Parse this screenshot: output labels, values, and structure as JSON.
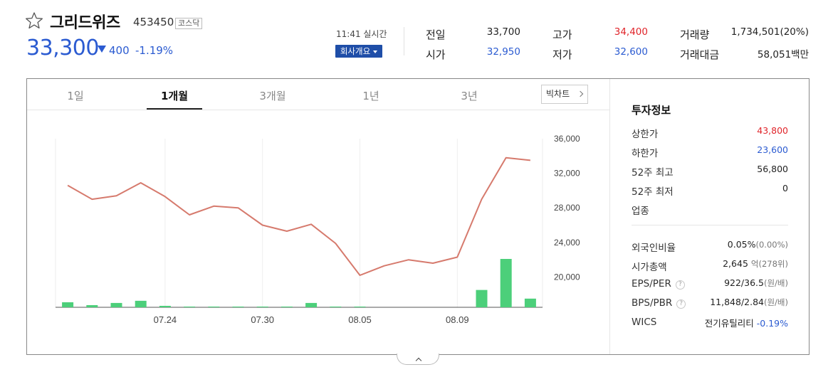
{
  "stock": {
    "name": "그리드위즈",
    "code": "453450",
    "market": "코스닥",
    "price": "33,300",
    "change": "400",
    "change_rate": "-1.19%",
    "direction": "down"
  },
  "realtime": {
    "time": "11:41 실시간",
    "company_button": "회사개요"
  },
  "quote": {
    "prev_close_label": "전일",
    "prev_close": "33,700",
    "open_label": "시가",
    "open": "32,950",
    "high_label": "고가",
    "high": "34,400",
    "low_label": "저가",
    "low": "32,600",
    "volume_label": "거래량",
    "volume": "1,734,501(20%)",
    "amount_label": "거래대금",
    "amount": "58,051백만"
  },
  "tabs": [
    "1일",
    "1개월",
    "3개월",
    "1년",
    "3년"
  ],
  "active_tab": "1개월",
  "bigchart_label": "빅차트",
  "chart_data": {
    "type": "line",
    "title": "",
    "x": [
      "07.18",
      "07.19",
      "07.22",
      "07.23",
      "07.24",
      "07.25",
      "07.26",
      "07.29",
      "07.30",
      "07.31",
      "08.01",
      "08.02",
      "08.05",
      "08.06",
      "08.07",
      "08.08",
      "08.09",
      "08.12",
      "08.13",
      "08.14"
    ],
    "x_tick_labels": [
      "07.24",
      "07.30",
      "08.05",
      "08.09"
    ],
    "series": [
      {
        "values": [
          30600,
          29000,
          29400,
          30900,
          29300,
          27200,
          28200,
          28000,
          26000,
          25300,
          26100,
          23900,
          20200,
          21300,
          22000,
          21600,
          22300,
          29000,
          33800,
          33500
        ]
      }
    ],
    "volume": [
      7,
      3,
      6,
      9,
      2,
      1,
      1,
      1,
      1,
      1,
      6,
      1,
      1,
      0,
      0,
      0,
      0,
      24,
      67,
      12
    ],
    "y_ticks": [
      "36,000",
      "32,000",
      "28,000",
      "24,000",
      "20,000"
    ],
    "ylim": [
      16500,
      36000
    ],
    "grid": true,
    "line_color": "#d67a6d",
    "volume_color": "#4ccf7a"
  },
  "invest": {
    "title": "투자정보",
    "upper_limit_label": "상한가",
    "upper_limit": "43,800",
    "lower_limit_label": "하한가",
    "lower_limit": "23,600",
    "high52_label": "52주 최고",
    "high52": "56,800",
    "low52_label": "52주 최저",
    "low52": "0",
    "industry_label": "업종",
    "foreign_label": "외국인비율",
    "foreign": "0.05%",
    "foreign_sub": "(0.00%)",
    "mcap_label": "시가총액",
    "mcap": "2,645",
    "mcap_unit": "억",
    "mcap_sub": "(278위)",
    "eps_per_label": "EPS/PER",
    "eps_per": "922/36.5",
    "eps_per_unit": "(원/배)",
    "bps_pbr_label": "BPS/PBR",
    "bps_pbr": "11,848/2.84",
    "bps_pbr_unit": "(원/배)",
    "wics_label": "WICS",
    "wics": "전기유틸리티",
    "wics_change": "-0.19%",
    "help_glyph": "?"
  },
  "colors": {
    "up": "#e0242a",
    "down": "#2b5bd1",
    "accent": "#1f4ea8"
  }
}
